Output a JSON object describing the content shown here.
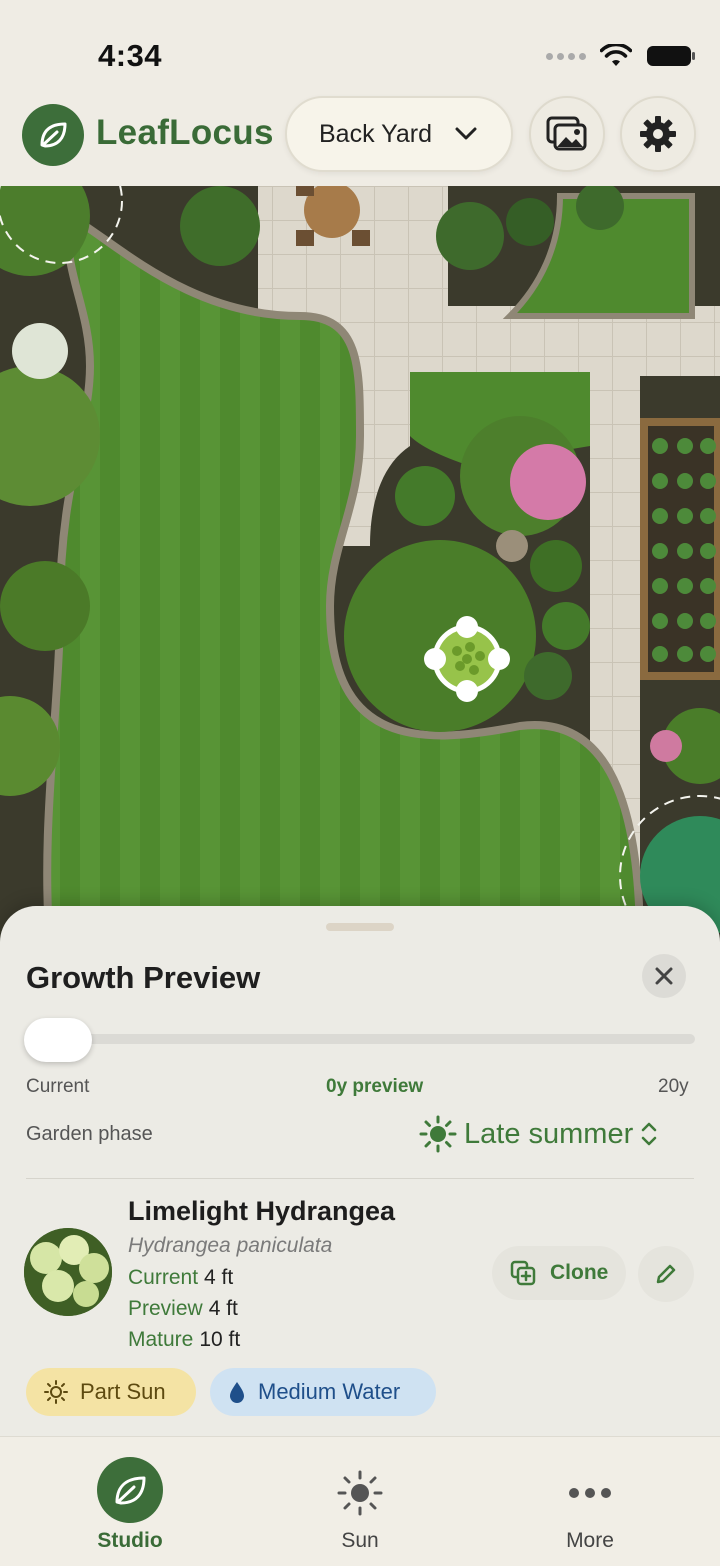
{
  "status_bar": {
    "time": "4:34"
  },
  "header": {
    "app_name": "LeafLocus",
    "yard_selector": "Back Yard",
    "icons": [
      "leaf-icon",
      "chevron-down-icon",
      "photo-gallery-icon",
      "gear-icon"
    ]
  },
  "sheet": {
    "title": "Growth Preview",
    "timeline": {
      "start_label": "Current",
      "preview_label": "0y preview",
      "end_label": "20y",
      "value_years": 0,
      "max_years": 20
    },
    "phase": {
      "label": "Garden phase",
      "value": "Late summer"
    },
    "plant": {
      "name": "Limelight Hydrangea",
      "scientific_name": "Hydrangea paniculata",
      "stats": [
        {
          "label": "Current",
          "value": "4 ft"
        },
        {
          "label": "Preview",
          "value": "4 ft"
        },
        {
          "label": "Mature",
          "value": "10 ft"
        }
      ],
      "clone_label": "Clone"
    },
    "badges": {
      "sun": "Part Sun",
      "water": "Medium Water"
    }
  },
  "tabs": [
    {
      "label": "Studio",
      "icon": "leaf-icon",
      "active": true
    },
    {
      "label": "Sun",
      "icon": "sun-icon",
      "active": false
    },
    {
      "label": "More",
      "icon": "more-icon",
      "active": false
    }
  ],
  "colors": {
    "brand_green": "#3d6e3a",
    "accent_green": "#3f7a3a",
    "sun_badge": "#f4e3a4",
    "water_badge": "#cfe2f2"
  }
}
